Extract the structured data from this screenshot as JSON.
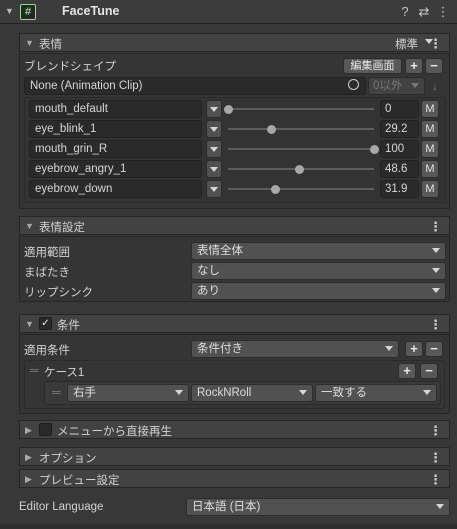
{
  "header": {
    "title": "FaceTune",
    "component_icon": "#",
    "help_icon": "?",
    "settings_icon": "⇄",
    "menu_icon": "⋮"
  },
  "expression": {
    "title": "表情",
    "preset": "標準",
    "blendshape_label": "ブレンドシェイプ",
    "edit_button": "編集画面",
    "clip_field": "None (Animation Clip)",
    "filter": "0以外",
    "rows": [
      {
        "name": "mouth_default",
        "value": "0",
        "fraction": 0.0
      },
      {
        "name": "eye_blink_1",
        "value": "29.2",
        "fraction": 0.292
      },
      {
        "name": "mouth_grin_R",
        "value": "100",
        "fraction": 1.0
      },
      {
        "name": "eyebrow_angry_1",
        "value": "48.6",
        "fraction": 0.486
      },
      {
        "name": "eyebrow_down",
        "value": "31.9",
        "fraction": 0.319
      }
    ],
    "m_label": "M"
  },
  "expression_settings": {
    "title": "表情設定",
    "rows": [
      {
        "label": "適用範囲",
        "value": "表情全体"
      },
      {
        "label": "まばたき",
        "value": "なし"
      },
      {
        "label": "リップシンク",
        "value": "あり"
      }
    ]
  },
  "conditions": {
    "title": "条件",
    "checked": true,
    "apply_label": "適用条件",
    "apply_value": "条件付き",
    "case_label": "ケース1",
    "hand": "右手",
    "gesture": "RockNRoll",
    "match": "一致する"
  },
  "menu_play": {
    "title": "メニューから直接再生",
    "checked": false
  },
  "options": {
    "title": "オプション"
  },
  "preview": {
    "title": "プレビュー設定"
  },
  "language": {
    "label": "Editor Language",
    "value": "日本語 (日本)"
  }
}
